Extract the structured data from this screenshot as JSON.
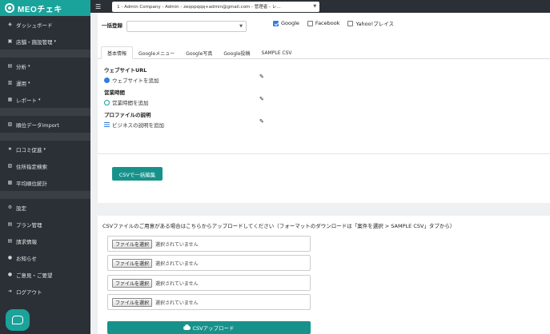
{
  "app": {
    "brand": "MEOチェキ"
  },
  "topbar": {
    "menu_icon": "hamburger-icon",
    "company_value": "1 - Admin Company - Admin - zeqopqqq+admin@gmail.com - 管理者 - レ…"
  },
  "sidebar": {
    "items": [
      {
        "label": "ダッシュボード",
        "icon": "dashboard-icon",
        "glyph": "◈"
      },
      {
        "label": "店舗・施設管理",
        "icon": "store-icon",
        "glyph": "▣",
        "dropdown": true
      },
      {
        "label": "分析",
        "icon": "analytics-icon",
        "glyph": "▤",
        "dropdown": true
      },
      {
        "label": "運用",
        "icon": "operation-icon",
        "glyph": "▥",
        "dropdown": true
      },
      {
        "label": "レポート",
        "icon": "report-icon",
        "glyph": "▦",
        "dropdown": true
      },
      {
        "label": "順位データimport",
        "icon": "import-icon",
        "glyph": "▧"
      },
      {
        "label": "口コミ促進",
        "icon": "star-icon",
        "glyph": "★",
        "dropdown": true
      },
      {
        "label": "住所指定検索",
        "icon": "address-search-icon",
        "glyph": "▨"
      },
      {
        "label": "平均順位統計",
        "icon": "stats-icon",
        "glyph": "▩"
      },
      {
        "label": "設定",
        "icon": "gear-icon",
        "glyph": "⚙"
      },
      {
        "label": "プラン管理",
        "icon": "plan-icon",
        "glyph": "▤"
      },
      {
        "label": "請求情報",
        "icon": "billing-icon",
        "glyph": "▤"
      },
      {
        "label": "お知らせ",
        "icon": "bell-icon",
        "glyph": "●"
      },
      {
        "label": "ご意見・ご要望",
        "icon": "feedback-icon",
        "glyph": "●"
      },
      {
        "label": "ログアウト",
        "icon": "logout-icon",
        "glyph": "➜"
      }
    ]
  },
  "bulk": {
    "label": "一括登録",
    "select_value": "",
    "options": [
      {
        "label": "Google",
        "checked": true
      },
      {
        "label": "Facebook",
        "checked": false
      },
      {
        "label": "Yahoo!プレイス",
        "checked": false
      }
    ]
  },
  "tabs": [
    {
      "label": "基本情報",
      "active": true
    },
    {
      "label": "Googleメニュー",
      "active": false
    },
    {
      "label": "Google写真",
      "active": false
    },
    {
      "label": "Google投稿",
      "active": false
    },
    {
      "label": "SAMPLE CSV",
      "active": false
    }
  ],
  "fields": [
    {
      "title": "ウェブサイトURL",
      "link": "ウェブサイトを追加",
      "icon": "globe-icon"
    },
    {
      "title": "営業時間",
      "link": "営業時間を追加",
      "icon": "clock-icon"
    },
    {
      "title": "プロファイルの説明",
      "link": "ビジネスの説明を追加",
      "icon": "description-icon"
    }
  ],
  "csv_edit_button": "CSVで一括編集",
  "upload": {
    "note": "CSVファイルのご用意がある場合はこちらからアップロードしてください（フォーマットのダウンロードは「案件を選択 > SAMPLE CSV」タブから）",
    "files": [
      {
        "button": "ファイルを選択",
        "status": "選択されていません"
      },
      {
        "button": "ファイルを選択",
        "status": "選択されていません"
      },
      {
        "button": "ファイルを選択",
        "status": "選択されていません"
      },
      {
        "button": "ファイルを選択",
        "status": "選択されていません"
      }
    ],
    "submit": "CSVアップロード"
  }
}
